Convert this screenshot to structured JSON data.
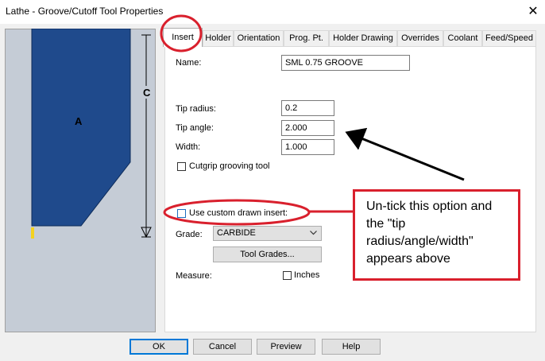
{
  "window": {
    "title": "Lathe - Groove/Cutoff Tool Properties",
    "close_glyph": "✕"
  },
  "preview": {
    "label_a": "A",
    "label_c": "C"
  },
  "tabs": [
    {
      "label": "Insert"
    },
    {
      "label": "Holder"
    },
    {
      "label": "Orientation"
    },
    {
      "label": "Prog. Pt."
    },
    {
      "label": "Holder Drawing"
    },
    {
      "label": "Overrides"
    },
    {
      "label": "Coolant"
    },
    {
      "label": "Feed/Speed"
    }
  ],
  "form": {
    "name_label": "Name:",
    "name_value": "SML 0.75 GROOVE",
    "tip_radius_label": "Tip radius:",
    "tip_radius_value": "0.2",
    "tip_angle_label": "Tip angle:",
    "tip_angle_value": "2.000",
    "width_label": "Width:",
    "width_value": "1.000",
    "cutgrip_label": "Cutgrip grooving tool",
    "custom_insert_label": "Use custom drawn insert:",
    "grade_label": "Grade:",
    "grade_value": "CARBIDE",
    "tool_grades_button": "Tool Grades...",
    "measure_label": "Measure:",
    "inches_label": "Inches"
  },
  "footer": {
    "ok": "OK",
    "cancel": "Cancel",
    "preview": "Preview",
    "help": "Help"
  },
  "annotation": {
    "callout_text": "Un-tick this option and the \"tip radius/angle/width\" appears above"
  },
  "colors": {
    "insert_fill": "#1f4a8c",
    "annotation_red": "#d9202d",
    "tip_yellow": "#f4d21f"
  }
}
